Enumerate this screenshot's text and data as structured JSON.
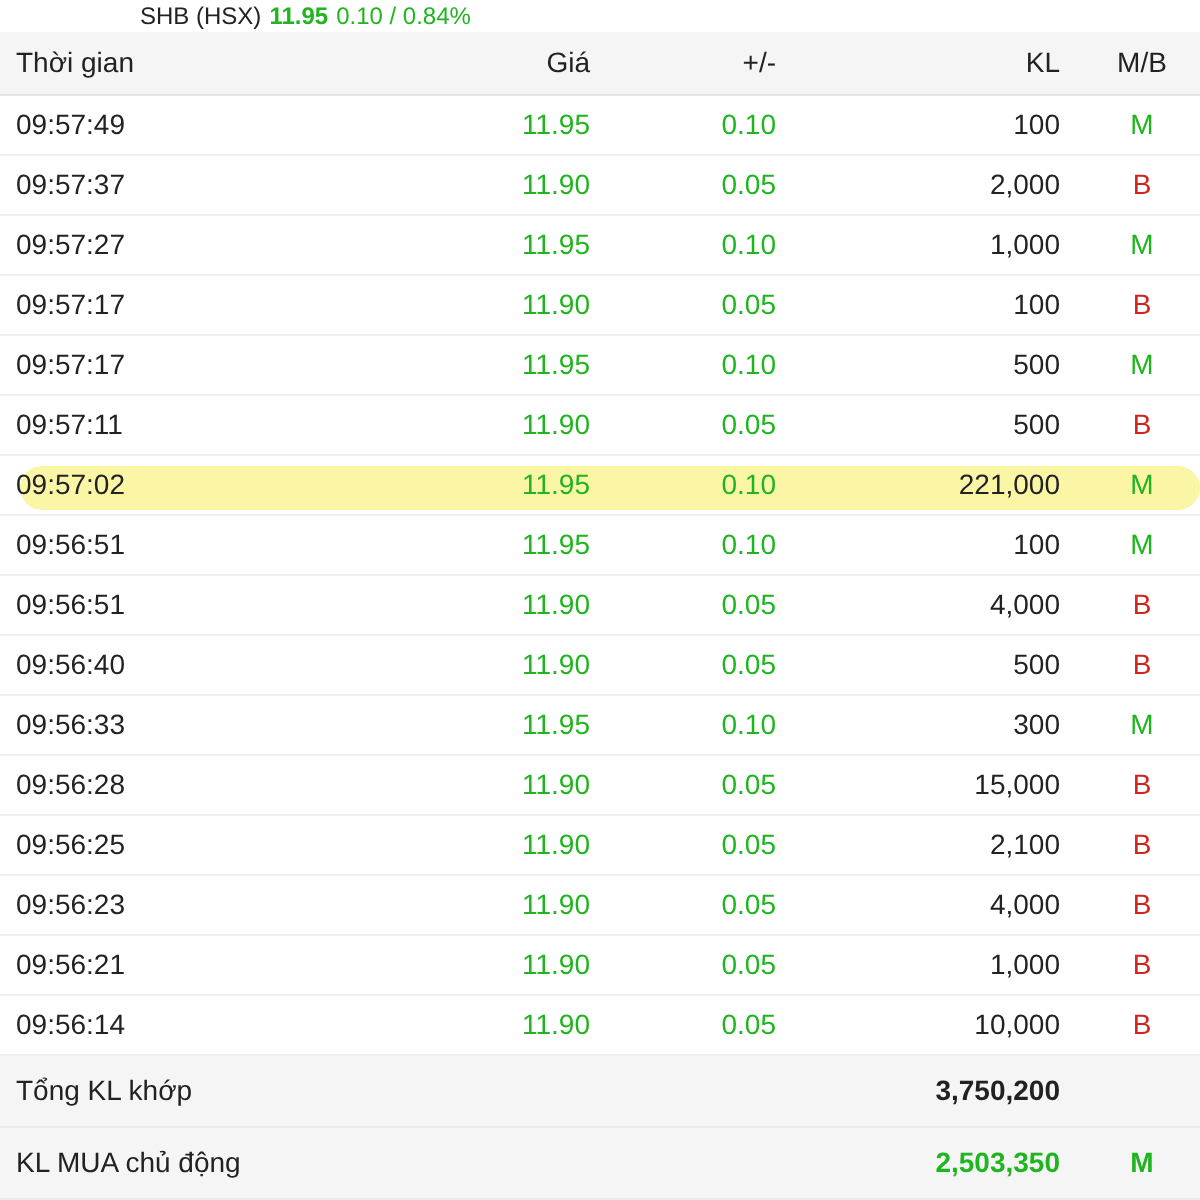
{
  "ticker": {
    "symbol": "SHB (HSX)",
    "price": "11.95",
    "change": "0.10 / 0.84%"
  },
  "columns": [
    "Thời gian",
    "Giá",
    "+/-",
    "KL",
    "M/B"
  ],
  "rows": [
    {
      "time": "09:57:49",
      "price": "11.95",
      "change": "0.10",
      "volume": "100",
      "side": "M",
      "kind": "buy",
      "highlighted": false
    },
    {
      "time": "09:57:37",
      "price": "11.90",
      "change": "0.05",
      "volume": "2,000",
      "side": "B",
      "kind": "sell",
      "highlighted": false
    },
    {
      "time": "09:57:27",
      "price": "11.95",
      "change": "0.10",
      "volume": "1,000",
      "side": "M",
      "kind": "buy",
      "highlighted": false
    },
    {
      "time": "09:57:17",
      "price": "11.90",
      "change": "0.05",
      "volume": "100",
      "side": "B",
      "kind": "sell",
      "highlighted": false
    },
    {
      "time": "09:57:17",
      "price": "11.95",
      "change": "0.10",
      "volume": "500",
      "side": "M",
      "kind": "buy",
      "highlighted": false
    },
    {
      "time": "09:57:11",
      "price": "11.90",
      "change": "0.05",
      "volume": "500",
      "side": "B",
      "kind": "sell",
      "highlighted": false
    },
    {
      "time": "09:57:02",
      "price": "11.95",
      "change": "0.10",
      "volume": "221,000",
      "side": "M",
      "kind": "buy",
      "highlighted": true
    },
    {
      "time": "09:56:51",
      "price": "11.95",
      "change": "0.10",
      "volume": "100",
      "side": "M",
      "kind": "buy",
      "highlighted": false
    },
    {
      "time": "09:56:51",
      "price": "11.90",
      "change": "0.05",
      "volume": "4,000",
      "side": "B",
      "kind": "sell",
      "highlighted": false
    },
    {
      "time": "09:56:40",
      "price": "11.90",
      "change": "0.05",
      "volume": "500",
      "side": "B",
      "kind": "sell",
      "highlighted": false
    },
    {
      "time": "09:56:33",
      "price": "11.95",
      "change": "0.10",
      "volume": "300",
      "side": "M",
      "kind": "buy",
      "highlighted": false
    },
    {
      "time": "09:56:28",
      "price": "11.90",
      "change": "0.05",
      "volume": "15,000",
      "side": "B",
      "kind": "sell",
      "highlighted": false
    },
    {
      "time": "09:56:25",
      "price": "11.90",
      "change": "0.05",
      "volume": "2,100",
      "side": "B",
      "kind": "sell",
      "highlighted": false
    },
    {
      "time": "09:56:23",
      "price": "11.90",
      "change": "0.05",
      "volume": "4,000",
      "side": "B",
      "kind": "sell",
      "highlighted": false
    },
    {
      "time": "09:56:21",
      "price": "11.90",
      "change": "0.05",
      "volume": "1,000",
      "side": "B",
      "kind": "sell",
      "highlighted": false
    },
    {
      "time": "09:56:14",
      "price": "11.90",
      "change": "0.05",
      "volume": "10,000",
      "side": "B",
      "kind": "sell",
      "highlighted": false
    }
  ],
  "summary": [
    {
      "label": "Tổng KL khớp",
      "value": "3,750,200",
      "kind": "total"
    },
    {
      "label": "KL MUA chủ động",
      "value": "2,503,350",
      "side": "M",
      "kind": "buy"
    }
  ]
}
